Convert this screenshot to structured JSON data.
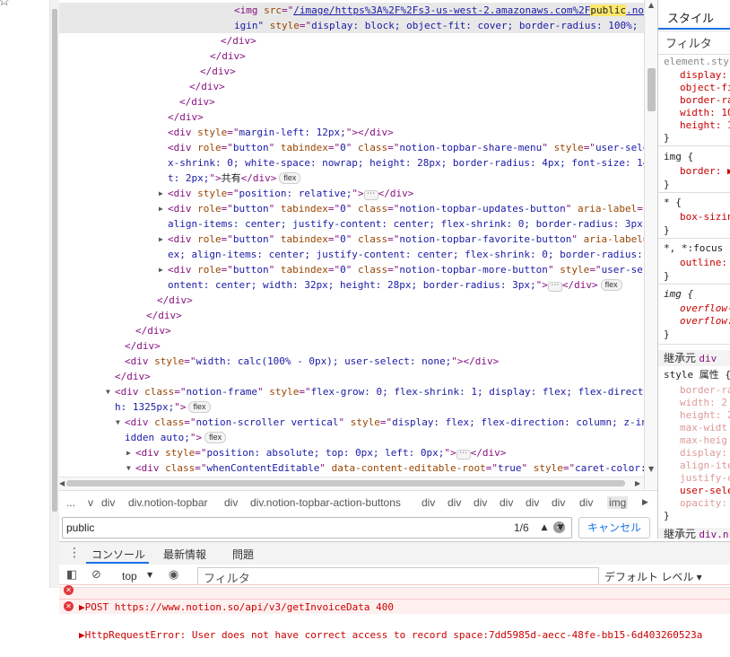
{
  "browser": {
    "bookmark_icon": "star-icon",
    "menu_icon": "more-horizontal-icon"
  },
  "elements": {
    "lines": [
      {
        "indent": 195,
        "selected": true,
        "parts": [
          [
            "tag",
            "<img "
          ],
          [
            "an",
            "src"
          ],
          [
            "tag",
            "=\""
          ],
          [
            "link",
            "/image/https%3A%2F%2Fs3-us-west-2.amazonaws.com%2F"
          ],
          [
            "hl",
            "public"
          ],
          [
            "link",
            ".no"
          ]
        ]
      },
      {
        "indent": 195,
        "selected": true,
        "parts": [
          [
            "av",
            "igin\""
          ],
          [
            "tag",
            " "
          ],
          [
            "an",
            "style"
          ],
          [
            "tag",
            "=\""
          ],
          [
            "av",
            "display: block; object-fit: cover; border-radius: 100%; w"
          ]
        ]
      },
      {
        "indent": 180,
        "parts": [
          [
            "tag",
            "</div>"
          ]
        ]
      },
      {
        "indent": 168,
        "parts": [
          [
            "tag",
            "</div>"
          ]
        ]
      },
      {
        "indent": 157,
        "parts": [
          [
            "tag",
            "</div>"
          ]
        ]
      },
      {
        "indent": 145,
        "parts": [
          [
            "tag",
            "</div>"
          ]
        ]
      },
      {
        "indent": 134,
        "parts": [
          [
            "tag",
            "</div>"
          ]
        ]
      },
      {
        "indent": 121,
        "parts": [
          [
            "tag",
            "</div>"
          ]
        ]
      },
      {
        "indent": 121,
        "parts": [
          [
            "tag",
            "<div "
          ],
          [
            "an",
            "style"
          ],
          [
            "tag",
            "=\""
          ],
          [
            "av",
            "margin-left: 12px;"
          ],
          [
            "tag",
            "\"></div>"
          ]
        ]
      },
      {
        "indent": 121,
        "parts": [
          [
            "tag",
            "<div "
          ],
          [
            "an",
            "role"
          ],
          [
            "tag",
            "=\""
          ],
          [
            "av",
            "button"
          ],
          [
            "tag",
            "\" "
          ],
          [
            "an",
            "tabindex"
          ],
          [
            "tag",
            "=\""
          ],
          [
            "av",
            "0"
          ],
          [
            "tag",
            "\" "
          ],
          [
            "an",
            "class"
          ],
          [
            "tag",
            "=\""
          ],
          [
            "av",
            "notion-topbar-share-menu"
          ],
          [
            "tag",
            "\" "
          ],
          [
            "an",
            "style"
          ],
          [
            "tag",
            "=\""
          ],
          [
            "av",
            "user-sele"
          ]
        ]
      },
      {
        "indent": 121,
        "parts": [
          [
            "av",
            "x-shrink: 0; white-space: nowrap; height: 28px; border-radius: 4px; font-size: 14"
          ]
        ]
      },
      {
        "indent": 121,
        "parts": [
          [
            "av",
            "t: 2px;"
          ],
          [
            "tag",
            "\">"
          ],
          [
            "txt",
            "共有"
          ],
          [
            "tag",
            "</div>"
          ],
          [
            "badge",
            "flex"
          ]
        ]
      },
      {
        "indent": 121,
        "tri": "▶",
        "parts": [
          [
            "tag",
            "<div "
          ],
          [
            "an",
            "style"
          ],
          [
            "tag",
            "=\""
          ],
          [
            "av",
            "position: relative;"
          ],
          [
            "tag",
            "\">"
          ],
          [
            "ell",
            "⋯"
          ],
          [
            "tag",
            "</div>"
          ]
        ]
      },
      {
        "indent": 121,
        "tri": "▶",
        "parts": [
          [
            "tag",
            "<div "
          ],
          [
            "an",
            "role"
          ],
          [
            "tag",
            "=\""
          ],
          [
            "av",
            "button"
          ],
          [
            "tag",
            "\" "
          ],
          [
            "an",
            "tabindex"
          ],
          [
            "tag",
            "=\""
          ],
          [
            "av",
            "0"
          ],
          [
            "tag",
            "\" "
          ],
          [
            "an",
            "class"
          ],
          [
            "tag",
            "=\""
          ],
          [
            "av",
            "notion-topbar-updates-button"
          ],
          [
            "tag",
            "\" "
          ],
          [
            "an",
            "aria-label"
          ],
          [
            "tag",
            "="
          ]
        ]
      },
      {
        "indent": 121,
        "parts": [
          [
            "av",
            "align-items: center; justify-content: center; flex-shrink: 0; border-radius: 3px; "
          ]
        ]
      },
      {
        "indent": 121,
        "tri": "▶",
        "parts": [
          [
            "tag",
            "<div "
          ],
          [
            "an",
            "role"
          ],
          [
            "tag",
            "=\""
          ],
          [
            "av",
            "button"
          ],
          [
            "tag",
            "\" "
          ],
          [
            "an",
            "tabindex"
          ],
          [
            "tag",
            "=\""
          ],
          [
            "av",
            "0"
          ],
          [
            "tag",
            "\" "
          ],
          [
            "an",
            "class"
          ],
          [
            "tag",
            "=\""
          ],
          [
            "av",
            "notion-topbar-favorite-button"
          ],
          [
            "tag",
            "\" "
          ],
          [
            "an",
            "aria-label"
          ],
          [
            "tag",
            "="
          ]
        ]
      },
      {
        "indent": 121,
        "parts": [
          [
            "av",
            "ex; align-items: center; justify-content: center; flex-shrink: 0; border-radius: "
          ]
        ]
      },
      {
        "indent": 121,
        "tri": "▶",
        "parts": [
          [
            "tag",
            "<div "
          ],
          [
            "an",
            "role"
          ],
          [
            "tag",
            "=\""
          ],
          [
            "av",
            "button"
          ],
          [
            "tag",
            "\" "
          ],
          [
            "an",
            "tabindex"
          ],
          [
            "tag",
            "=\""
          ],
          [
            "av",
            "0"
          ],
          [
            "tag",
            "\" "
          ],
          [
            "an",
            "class"
          ],
          [
            "tag",
            "=\""
          ],
          [
            "av",
            "notion-topbar-more-button"
          ],
          [
            "tag",
            "\" "
          ],
          [
            "an",
            "style"
          ],
          [
            "tag",
            "=\""
          ],
          [
            "av",
            "user-se"
          ]
        ]
      },
      {
        "indent": 121,
        "parts": [
          [
            "av",
            "ontent: center; width: 32px; height: 28px; border-radius: 3px;"
          ],
          [
            "tag",
            "\">"
          ],
          [
            "ell",
            "⋯"
          ],
          [
            "tag",
            "</div>"
          ],
          [
            "badge",
            "flex"
          ]
        ]
      },
      {
        "indent": 109,
        "parts": [
          [
            "tag",
            "</div>"
          ]
        ]
      },
      {
        "indent": 97,
        "parts": [
          [
            "tag",
            "</div>"
          ]
        ]
      },
      {
        "indent": 85,
        "parts": [
          [
            "tag",
            "</div>"
          ]
        ]
      },
      {
        "indent": 73,
        "parts": [
          [
            "tag",
            "</div>"
          ]
        ]
      },
      {
        "indent": 73,
        "parts": [
          [
            "tag",
            "<div "
          ],
          [
            "an",
            "style"
          ],
          [
            "tag",
            "=\""
          ],
          [
            "av",
            "width: calc(100% - 0px); user-select: none;"
          ],
          [
            "tag",
            "\"></div>"
          ]
        ]
      },
      {
        "indent": 62,
        "parts": [
          [
            "tag",
            "</div>"
          ]
        ]
      },
      {
        "indent": 62,
        "tri": "▼",
        "parts": [
          [
            "tag",
            "<div "
          ],
          [
            "an",
            "class"
          ],
          [
            "tag",
            "=\""
          ],
          [
            "av",
            "notion-frame"
          ],
          [
            "tag",
            "\" "
          ],
          [
            "an",
            "style"
          ],
          [
            "tag",
            "=\""
          ],
          [
            "av",
            "flex-grow: 0; flex-shrink: 1; display: flex; flex-direct"
          ]
        ]
      },
      {
        "indent": 62,
        "parts": [
          [
            "av",
            "h: 1325px;"
          ],
          [
            "tag",
            "\">"
          ],
          [
            "badge",
            "flex"
          ]
        ]
      },
      {
        "indent": 73,
        "tri": "▼",
        "parts": [
          [
            "tag",
            "<div "
          ],
          [
            "an",
            "class"
          ],
          [
            "tag",
            "=\""
          ],
          [
            "av",
            "notion-scroller vertical"
          ],
          [
            "tag",
            "\" "
          ],
          [
            "an",
            "style"
          ],
          [
            "tag",
            "=\""
          ],
          [
            "av",
            "display: flex; flex-direction: column; z-in"
          ]
        ]
      },
      {
        "indent": 73,
        "parts": [
          [
            "av",
            "idden auto;"
          ],
          [
            "tag",
            "\">"
          ],
          [
            "badge",
            "flex"
          ]
        ]
      },
      {
        "indent": 85,
        "tri": "▶",
        "parts": [
          [
            "tag",
            "<div "
          ],
          [
            "an",
            "style"
          ],
          [
            "tag",
            "=\""
          ],
          [
            "av",
            "position: absolute; top: 0px; left: 0px;"
          ],
          [
            "tag",
            "\">"
          ],
          [
            "ell",
            "⋯"
          ],
          [
            "tag",
            "</div>"
          ]
        ]
      },
      {
        "indent": 85,
        "tri": "▼",
        "parts": [
          [
            "tag",
            "<div "
          ],
          [
            "an",
            "class"
          ],
          [
            "tag",
            "=\""
          ],
          [
            "av",
            "whenContentEditable"
          ],
          [
            "tag",
            "\" "
          ],
          [
            "an",
            "data-content-editable-root"
          ],
          [
            "tag",
            "=\""
          ],
          [
            "av",
            "true"
          ],
          [
            "tag",
            "\" "
          ],
          [
            "an",
            "style"
          ],
          [
            "tag",
            "=\""
          ],
          [
            "av",
            "caret-color:"
          ]
        ]
      }
    ]
  },
  "breadcrumbs": {
    "items": [
      "...",
      "v",
      "div",
      "div.notion-topbar",
      "div",
      "div.notion-topbar-action-buttons",
      "div",
      "div",
      "div",
      "div",
      "div",
      "div",
      "div",
      "img"
    ]
  },
  "search": {
    "value": "public",
    "count": "1/6",
    "cancel_label": "キャンセル"
  },
  "styles": {
    "tab_label": "スタイル",
    "filter_placeholder": "フィルタ",
    "element_style_selector": "element.styl",
    "element_style_props": [
      "display:",
      "object-fi",
      "border-ra",
      "width: 10",
      "height: 1"
    ],
    "img_rule_selector": "img {",
    "img_rule_prop": "border: ▶",
    "star_rule_selector": "* {",
    "star_rule_prop": "box-sizin",
    "focus_rule_selector": "*, *:focus",
    "focus_rule_prop": "outline: ▶",
    "img_italic_selector": "img {",
    "img_italic_props": [
      "overflow-",
      "overflow:"
    ],
    "inherited_label": "継承元",
    "inherited_from": "div",
    "style_attr_label": "style 属性 {",
    "inherited_props": [
      "border-ra",
      "width: 2",
      "height: 2",
      "max-widt",
      "max-heig",
      "display:",
      "align-ite",
      "justify-c",
      "user-sele",
      "opacity:"
    ],
    "inherited_label_2": "継承元",
    "inherited_from_2": "div.n"
  },
  "drawer": {
    "tabs": [
      "コンソール",
      "最新情報",
      "問題"
    ],
    "context": "top",
    "filter_placeholder": "フィルタ",
    "level_label": "デフォルト レベル ▾"
  },
  "console": {
    "row1": "▶POST https://www.notion.so/api/v3/getInvoiceData 400",
    "row2": "▶HttpRequestError: User does not have correct access to record space:7dd5985d-aecc-48fe-bb15-6d403260523a"
  },
  "colors": {
    "tag": "#881280",
    "attr_name": "#994500",
    "attr_value": "#1a1aa6",
    "accent": "#1a73e8",
    "error": "#cc0000"
  }
}
